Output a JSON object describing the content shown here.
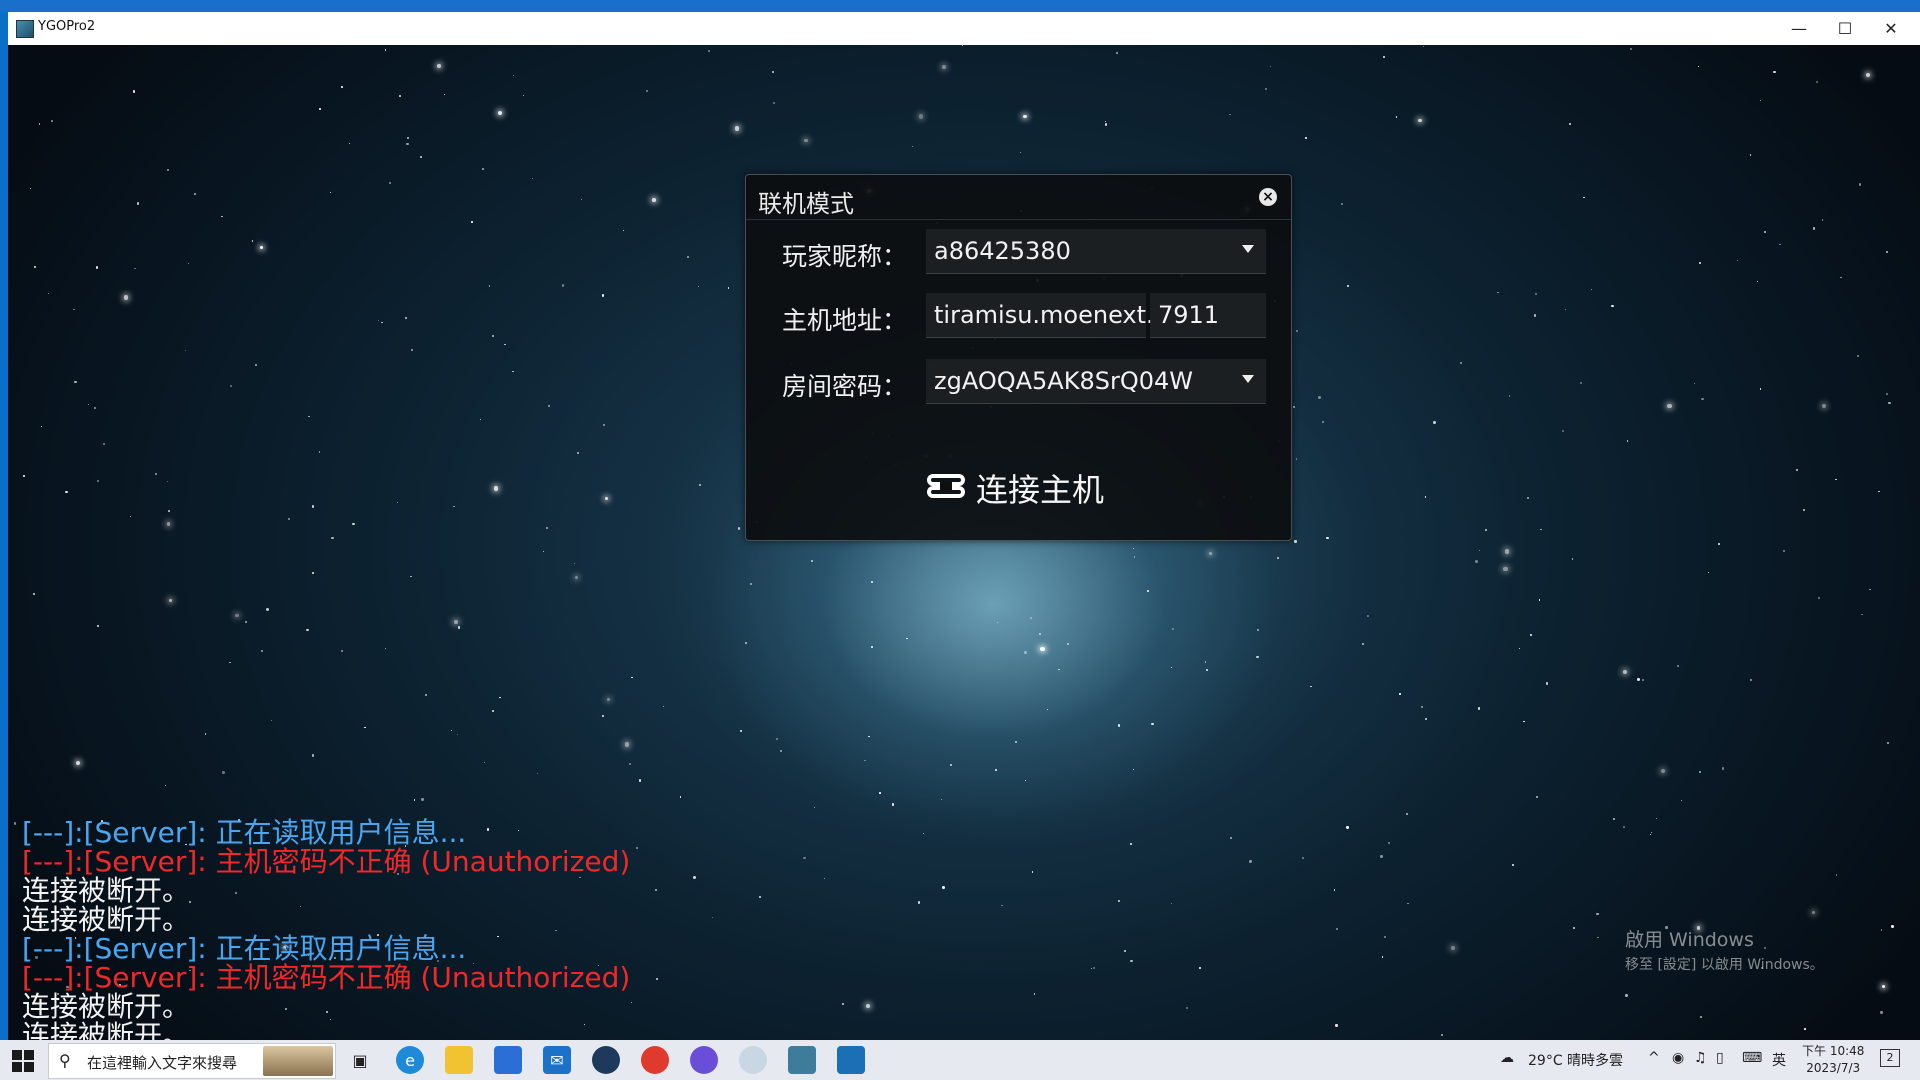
{
  "window": {
    "title": "YGOPro2",
    "controls": {
      "minimize": "—",
      "maximize": "☐",
      "close": "✕"
    }
  },
  "dialog": {
    "title": "联机模式",
    "close_label": "×",
    "nickname_label": "玩家昵称：",
    "nickname_value": "a86425380",
    "host_label": "主机地址：",
    "host_value": "tiramisu.moenext.",
    "port_value": "7911",
    "password_label": "房间密码：",
    "password_value": "zgAOQA5AK8SrQ04W",
    "connect_label": "连接主机"
  },
  "log": [
    {
      "text": "[---]:[Server]: 正在读取用户信息...",
      "color": "#4aa6f0"
    },
    {
      "text": "[---]:[Server]: 主机密码不正确 (Unauthorized)",
      "color": "#f02828"
    },
    {
      "text": "连接被断开。",
      "color": "#f3f3f3"
    },
    {
      "text": "连接被断开。",
      "color": "#f3f3f3"
    },
    {
      "text": "[---]:[Server]: 正在读取用户信息...",
      "color": "#4aa6f0"
    },
    {
      "text": "[---]:[Server]: 主机密码不正确 (Unauthorized)",
      "color": "#f02828"
    },
    {
      "text": "连接被断开。",
      "color": "#f3f3f3"
    },
    {
      "text": "连接被断开。",
      "color": "#f3f3f3"
    }
  ],
  "watermark": {
    "line1": "啟用 Windows",
    "line2": "移至 [設定] 以啟用 Windows。"
  },
  "taskbar": {
    "search_placeholder": "在這裡輸入文字來搜尋",
    "weather": "29°C  晴時多雲",
    "ime": "英",
    "time": "下午 10:48",
    "date": "2023/7/3",
    "notifications": "2"
  }
}
